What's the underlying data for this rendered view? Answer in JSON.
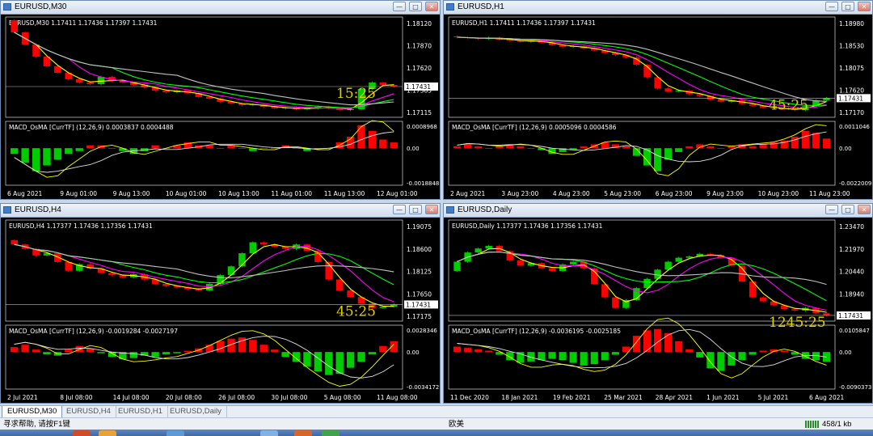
{
  "windows": [
    {
      "id": "m30",
      "title": "EURUSD,M30",
      "info": "EURUSD,M30  1.17411 1.17436 1.17397 1.17431",
      "timer": "15:25",
      "price_label": "1.17431",
      "yticks": [
        "1.18120",
        "1.17870",
        "1.17620",
        "1.17365",
        "1.17115"
      ],
      "macd_label": "MACD_OsMA [CurrTF] (12,26,9) 0.0003837 0.0004488",
      "macd_ticks": [
        "0.0008968",
        "0.00",
        "-0.0018848"
      ],
      "xticks": [
        "6 Aug 2021",
        "9 Aug 01:00",
        "9 Aug 13:00",
        "10 Aug 01:00",
        "10 Aug 13:00",
        "11 Aug 01:00",
        "11 Aug 13:00",
        "12 Aug 01:00"
      ],
      "chart_data": {
        "type": "candlestick",
        "ylim": [
          1.1705,
          1.1815
        ],
        "close": [
          1.181,
          1.1795,
          1.178,
          1.1768,
          1.176,
          1.1752,
          1.1748,
          1.1746,
          1.1755,
          1.175,
          1.1748,
          1.1745,
          1.1742,
          1.1738,
          1.1736,
          1.1738,
          1.1735,
          1.173,
          1.1728,
          1.1724,
          1.1722,
          1.172,
          1.1721,
          1.1718,
          1.1716,
          1.1717,
          1.1715,
          1.1716,
          1.1718,
          1.1716,
          1.1714,
          1.1715,
          1.174,
          1.1748,
          1.1745,
          1.1743
        ],
        "macd_hist": [
          -0.0002,
          -0.0005,
          -0.0008,
          -0.0006,
          -0.0004,
          -0.0002,
          -0.0001,
          0.0001,
          0.0001,
          0.0,
          -0.0001,
          -0.0002,
          -0.0001,
          0.0001,
          0.0,
          0.0001,
          0.0002,
          0.0001,
          0.0001,
          0.0,
          0.0001,
          0.0,
          -0.0001,
          0.0,
          0.0,
          0.0001,
          0.0,
          -0.0001,
          0.0,
          0.0,
          0.0002,
          0.0004,
          0.0008,
          0.0006,
          0.0003,
          0.0002
        ]
      }
    },
    {
      "id": "h1",
      "title": "EURUSD,H1",
      "info": "EURUSD,H1  1.17411 1.17436 1.17397 1.17431",
      "timer": "45:25",
      "price_label": "1.17431",
      "yticks": [
        "1.18980",
        "1.18530",
        "1.18075",
        "1.17620",
        "1.17170"
      ],
      "macd_label": "MACD_OsMA [CurrTF] (12,26,9) 0.0005096 0.0004586",
      "macd_ticks": [
        "0.0011046",
        "0.00",
        "-0.0022009"
      ],
      "xticks": [
        "2 Aug 2021",
        "3 Aug 23:00",
        "4 Aug 23:00",
        "5 Aug 23:00",
        "6 Aug 23:00",
        "9 Aug 23:00",
        "10 Aug 23:00",
        "11 Aug 23:00"
      ],
      "chart_data": {
        "type": "candlestick",
        "ylim": [
          1.17,
          1.19
        ],
        "close": [
          1.188,
          1.1878,
          1.1876,
          1.1879,
          1.1875,
          1.1872,
          1.187,
          1.1873,
          1.1868,
          1.1862,
          1.1858,
          1.186,
          1.1855,
          1.185,
          1.1845,
          1.184,
          1.1835,
          1.1818,
          1.179,
          1.1765,
          1.1758,
          1.176,
          1.1752,
          1.1748,
          1.174,
          1.1735,
          1.1738,
          1.173,
          1.1726,
          1.1722,
          1.172,
          1.1718,
          1.1716,
          1.1725,
          1.1738,
          1.1743
        ],
        "macd_hist": [
          0.0001,
          0.0002,
          0.0001,
          0.0,
          0.0001,
          0.0002,
          0.0001,
          0.0,
          -0.0001,
          -0.0003,
          -0.0002,
          -0.0001,
          0.0001,
          0.0002,
          0.0003,
          0.0002,
          0.0001,
          -0.0004,
          -0.0009,
          -0.0012,
          -0.0006,
          -0.0002,
          0.0001,
          0.0002,
          0.0001,
          0.0,
          0.0001,
          0.0002,
          0.0001,
          0.0002,
          0.0003,
          0.0004,
          0.0006,
          0.0009,
          0.0008,
          0.0005
        ]
      }
    },
    {
      "id": "h4",
      "title": "EURUSD,H4",
      "info": "EURUSD,H4  1.17377 1.17436 1.17356 1.17431",
      "timer": "45:25",
      "price_label": "1.17431",
      "yticks": [
        "1.19075",
        "1.18600",
        "1.18125",
        "1.17650",
        "1.17175"
      ],
      "macd_label": "MACD_OsMA [CurrTF] (12,26,9) -0.0019284 -0.0027197",
      "macd_ticks": [
        "0.0028346",
        "0.00",
        "-0.0034172"
      ],
      "xticks": [
        "2 Jul 2021",
        "8 Jul 08:00",
        "14 Jul 08:00",
        "20 Jul 08:00",
        "26 Jul 08:00",
        "30 Jul 08:00",
        "5 Aug 08:00",
        "11 Aug 08:00"
      ],
      "chart_data": {
        "type": "candlestick",
        "ylim": [
          1.1705,
          1.191
        ],
        "close": [
          1.188,
          1.187,
          1.1855,
          1.186,
          1.184,
          1.182,
          1.1835,
          1.1825,
          1.1815,
          1.181,
          1.1805,
          1.1812,
          1.18,
          1.179,
          1.1785,
          1.1782,
          1.1778,
          1.1775,
          1.179,
          1.181,
          1.183,
          1.186,
          1.1885,
          1.188,
          1.1875,
          1.187,
          1.188,
          1.1865,
          1.184,
          1.18,
          1.1775,
          1.176,
          1.1745,
          1.1735,
          1.1738,
          1.1743
        ],
        "macd_hist": [
          0.0004,
          0.0006,
          0.0002,
          -0.0002,
          -0.0003,
          0.0002,
          0.0005,
          0.0003,
          -0.0001,
          -0.0004,
          -0.0006,
          -0.0005,
          -0.0003,
          -0.0004,
          -0.0002,
          -0.0001,
          0.0001,
          0.0003,
          0.0006,
          0.0009,
          0.0011,
          0.0012,
          0.001,
          0.0006,
          0.0002,
          -0.0004,
          -0.0008,
          -0.0012,
          -0.0016,
          -0.0019,
          -0.0018,
          -0.0013,
          -0.0008,
          -0.0002,
          0.0005,
          0.0009
        ]
      }
    },
    {
      "id": "daily",
      "title": "EURUSD,Daily",
      "info": "EURUSD,Daily  1.17377 1.17436 1.17356 1.17431",
      "timer": "1245:25",
      "price_label": "1.17431",
      "yticks": [
        "1.23470",
        "1.21970",
        "1.20440",
        "1.18940",
        "1.17431"
      ],
      "macd_label": "MACD_OsMA [CurrTF] (12,26,9) -0.0036195 -0.0025185",
      "macd_ticks": [
        "0.0105847",
        "0.00",
        "-0.0090373"
      ],
      "xticks": [
        "11 Dec 2020",
        "18 Jan 2021",
        "19 Feb 2021",
        "25 Mar 2021",
        "28 Apr 2021",
        "1 Jun 2021",
        "5 Jul 2021",
        "6 Aug 2021"
      ],
      "chart_data": {
        "type": "candlestick",
        "ylim": [
          1.17,
          1.238
        ],
        "close": [
          1.215,
          1.222,
          1.225,
          1.227,
          1.223,
          1.216,
          1.212,
          1.214,
          1.21,
          1.208,
          1.213,
          1.215,
          1.21,
          1.198,
          1.188,
          1.18,
          1.186,
          1.195,
          1.202,
          1.209,
          1.215,
          1.218,
          1.219,
          1.221,
          1.22,
          1.218,
          1.212,
          1.2,
          1.188,
          1.185,
          1.182,
          1.179,
          1.178,
          1.18,
          1.176,
          1.1743
        ],
        "macd_hist": [
          0.002,
          0.0015,
          0.001,
          0.0005,
          -0.001,
          -0.003,
          -0.004,
          -0.0035,
          -0.003,
          -0.0025,
          -0.003,
          -0.004,
          -0.005,
          -0.0045,
          -0.003,
          -0.001,
          0.002,
          0.006,
          0.008,
          0.0085,
          0.007,
          0.004,
          0.001,
          -0.002,
          -0.006,
          -0.007,
          -0.005,
          -0.003,
          -0.001,
          0.0005,
          0.001,
          0.0005,
          -0.001,
          -0.0025,
          -0.003,
          -0.0036
        ]
      }
    }
  ],
  "tabs": [
    "EURUSD,M30",
    "EURUSD,H4",
    "EURUSD,H1",
    "EURUSD,Daily"
  ],
  "status": {
    "help": "寻求帮助, 请按F1键",
    "profile": "欧美",
    "traffic": "458/1 kb"
  },
  "colors": {
    "bull": "#00cc00",
    "bear": "#ff0000",
    "ma_fast": "#ffff00",
    "ma_mid": "#ff00ff",
    "ma_slow": "#00ff00",
    "ma_long": "#c0c0c0",
    "timer": "#e0d000",
    "price_box": "#ffffff"
  }
}
